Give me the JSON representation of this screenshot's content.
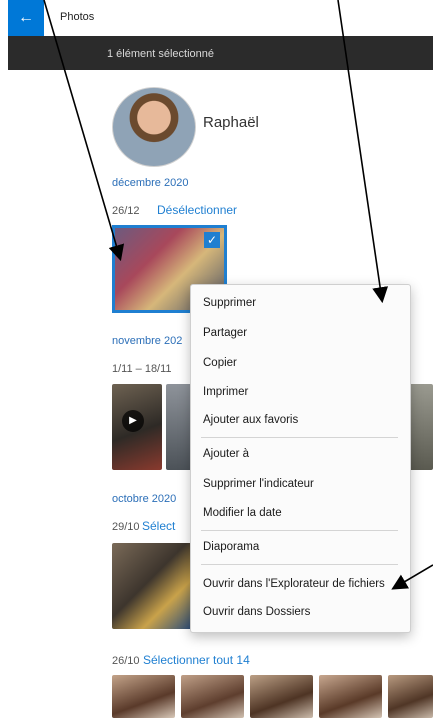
{
  "titlebar": {
    "back_icon": "←",
    "app_title": "Photos"
  },
  "selection_bar": {
    "text": "1 élément sélectionné"
  },
  "person": {
    "name": "Raphaël"
  },
  "sections": [
    {
      "month": "décembre 2020",
      "date": "26/12",
      "action": "Désélectionner"
    },
    {
      "month": "novembre 202",
      "date": "1/11 – 18/11"
    },
    {
      "month": "octobre 2020",
      "date": "29/10",
      "action": "Sélect"
    },
    {
      "date": "26/10",
      "action": "Sélectionner tout 14"
    }
  ],
  "context_menu": {
    "items": [
      "Supprimer",
      "Partager",
      "Copier",
      "Imprimer",
      "Ajouter aux favoris",
      "Ajouter à",
      "Supprimer l'indicateur",
      "Modifier la date",
      "Diaporama",
      "Ouvrir dans l'Explorateur de fichiers",
      "Ouvrir dans Dossiers"
    ]
  },
  "colors": {
    "accent": "#1f7fd1",
    "selection_bar": "#2b2b2b",
    "back_button": "#0078d7"
  }
}
